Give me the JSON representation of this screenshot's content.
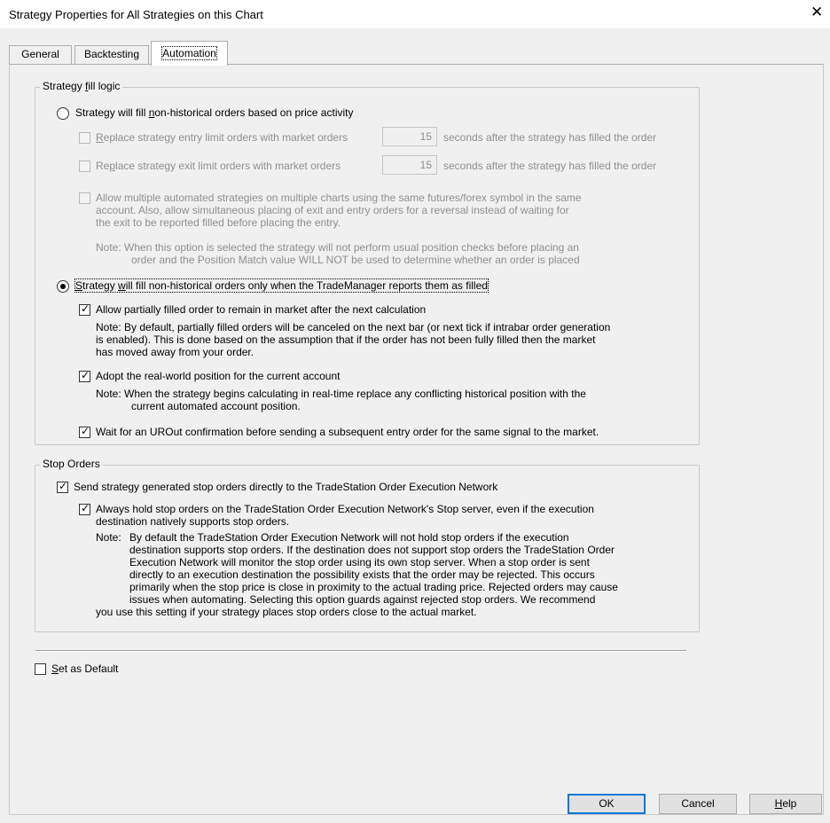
{
  "window": {
    "title": "Strategy Properties for All Strategies on this Chart",
    "close_glyph": "✕"
  },
  "tabs": [
    {
      "label": "General",
      "active": false
    },
    {
      "label": "Backtesting",
      "active": false
    },
    {
      "label": "Automation",
      "active": true
    }
  ],
  "fill_logic": {
    "legend": "Strategy fill logic",
    "option1": {
      "label": "Strategy will fill non-historical orders based on price activity",
      "selected": false,
      "replace_entry": {
        "label": "Replace strategy entry limit orders with market orders",
        "value": "15",
        "suffix": "seconds after the strategy has filled the order",
        "checked": false
      },
      "replace_exit": {
        "label": "Replace strategy exit limit orders with market orders",
        "value": "15",
        "suffix": "seconds after the strategy has filled the order",
        "checked": false
      },
      "allow_multiple": {
        "line1": "Allow multiple automated strategies on multiple charts using the same futures/forex symbol in the same",
        "line2": "account.  Also, allow simultaneous placing of exit and entry orders for a reversal instead of waiting for",
        "line3": "the exit to be reported filled before placing the entry.",
        "checked": false
      },
      "note": {
        "line1": "Note: When this option is selected the strategy will not perform usual position checks before placing an",
        "line2": "order and the Position Match value WILL NOT be used to determine whether an order is placed"
      }
    },
    "option2": {
      "label": "Strategy will fill non-historical orders only when the TradeManager reports them as filled",
      "selected": true,
      "allow_partial": {
        "label": "Allow partially filled order to remain in market after the next calculation",
        "checked": true,
        "note1": "Note: By default, partially filled orders will be canceled on the next bar (or next tick if intrabar order generation",
        "note2": "is enabled).  This is done based on the assumption that if the order has not been fully filled then the market",
        "note3": "has moved away from your order."
      },
      "adopt_position": {
        "label": "Adopt the real-world position for the current account",
        "checked": true,
        "note1": "Note:  When the strategy begins calculating in real-time replace any conflicting historical position with the",
        "note2": "current automated account position."
      },
      "wait_urout": {
        "label": "Wait for an UROut confirmation before sending a subsequent entry order for the same signal to the market.",
        "checked": true
      }
    }
  },
  "stop_orders": {
    "legend": "Stop Orders",
    "send_direct": {
      "label": "Send strategy generated stop orders directly to the TradeStation Order Execution Network",
      "checked": true
    },
    "always_hold": {
      "line1": "Always hold stop orders on the TradeStation Order Execution Network's Stop server, even if the execution",
      "line2": "destination natively supports stop orders.",
      "checked": true
    },
    "note": {
      "prefix": "Note:",
      "line1": "By default the TradeStation Order Execution Network will not hold stop orders if the execution",
      "line2": "destination supports stop orders.  If the destination does not support stop orders the TradeStation Order",
      "line3": "Execution Network will monitor the stop order using its own stop server.  When a stop order is sent",
      "line4": "directly to an execution destination the possibility exists that the order may be rejected.  This occurs",
      "line5": "primarily when the stop price is close in proximity to the actual trading price.  Rejected orders may cause",
      "line6": "issues when automating.  Selecting this option guards against rejected stop orders.  We recommend",
      "line7": "you use this setting if your strategy places stop orders close to the actual market."
    }
  },
  "set_default": {
    "label": "Set as Default",
    "checked": false
  },
  "buttons": {
    "ok": "OK",
    "cancel": "Cancel",
    "help": "Help"
  },
  "icons": {
    "close": "close-icon",
    "check": "check-icon",
    "radio": "radio-dot-icon"
  }
}
